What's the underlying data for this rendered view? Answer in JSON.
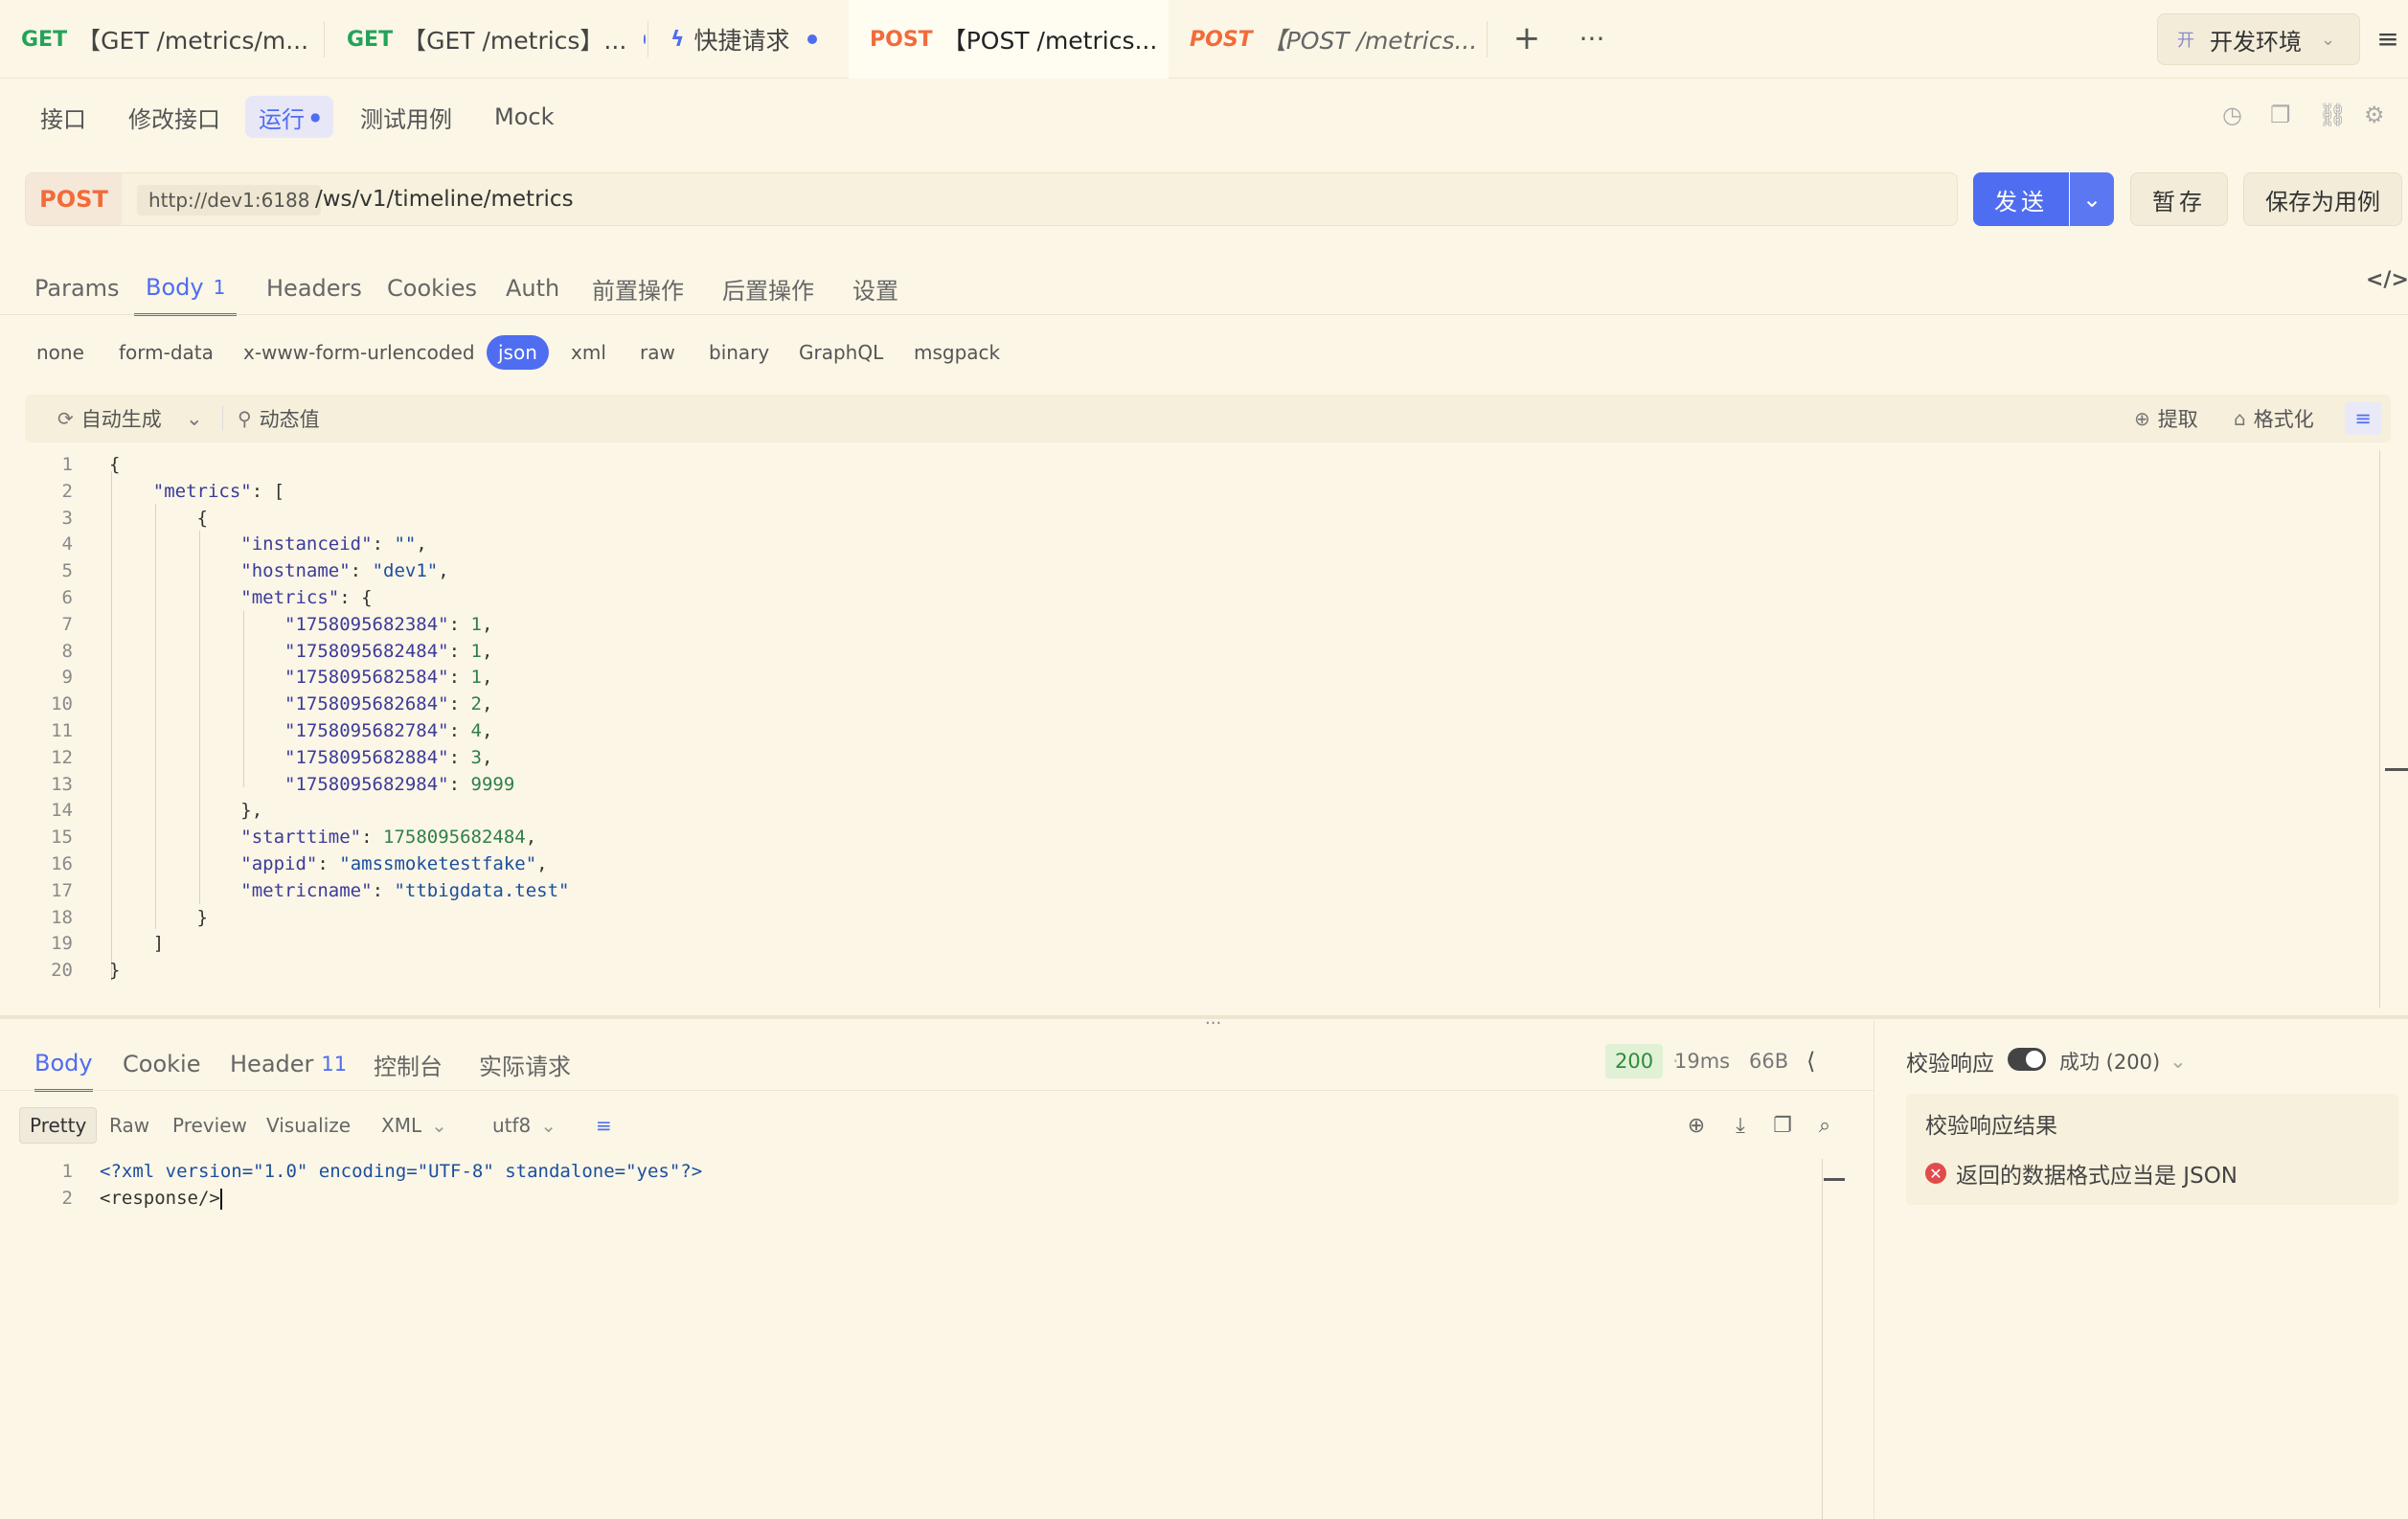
{
  "tabs": [
    {
      "method": "GET",
      "title": "【GET /metrics/m...",
      "dot": true
    },
    {
      "method": "GET",
      "title": "【GET /metrics】...",
      "dot": true
    },
    {
      "method": "",
      "title": "快捷请求",
      "dot": true
    },
    {
      "method": "POST",
      "title": "【POST /metrics...",
      "dot": true
    },
    {
      "method": "POST",
      "title": "【POST /metrics...",
      "dot": false
    }
  ],
  "env": {
    "prefix": "开",
    "label": "开发环境"
  },
  "subnav": [
    "接口",
    "修改接口",
    "运行",
    "测试用例",
    "Mock"
  ],
  "request": {
    "method": "POST",
    "host": "http://dev1:6188",
    "path": "/ws/v1/timeline/metrics",
    "send_label": "发送",
    "save_tmp_label": "暂存",
    "save_case_label": "保存为用例"
  },
  "req_tabs": [
    {
      "label": "Params"
    },
    {
      "label": "Body",
      "badge": "1"
    },
    {
      "label": "Headers"
    },
    {
      "label": "Cookies"
    },
    {
      "label": "Auth"
    },
    {
      "label": "前置操作"
    },
    {
      "label": "后置操作"
    },
    {
      "label": "设置"
    }
  ],
  "body_types": [
    "none",
    "form-data",
    "x-www-form-urlencoded",
    "json",
    "xml",
    "raw",
    "binary",
    "GraphQL",
    "msgpack"
  ],
  "editor_toolbar": {
    "auto_gen": "自动生成",
    "dynamic": "动态值",
    "extract": "提取",
    "format": "格式化"
  },
  "code_lines": [
    "{",
    "    \"metrics\": [",
    "        {",
    "            \"instanceid\": \"\",",
    "            \"hostname\": \"dev1\",",
    "            \"metrics\": {",
    "                \"1758095682384\": 1,",
    "                \"1758095682484\": 1,",
    "                \"1758095682584\": 1,",
    "                \"1758095682684\": 2,",
    "                \"1758095682784\": 4,",
    "                \"1758095682884\": 3,",
    "                \"1758095682984\": 9999",
    "            },",
    "            \"starttime\": 1758095682484,",
    "            \"appid\": \"amssmoketestfake\",",
    "            \"metricname\": \"ttbigdata.test\"",
    "        }",
    "    ]",
    "}"
  ],
  "response": {
    "tabs": [
      {
        "label": "Body"
      },
      {
        "label": "Cookie"
      },
      {
        "label": "Header",
        "badge": "11"
      },
      {
        "label": "控制台"
      },
      {
        "label": "实际请求"
      }
    ],
    "status": "200",
    "time": "19ms",
    "size": "66B",
    "formats": [
      "Pretty",
      "Raw",
      "Preview",
      "Visualize"
    ],
    "lang": "XML",
    "encoding": "utf8",
    "lines": [
      "<?xml version=\"1.0\" encoding=\"UTF-8\" standalone=\"yes\"?>",
      "<response/>"
    ]
  },
  "validation": {
    "label": "校验响应",
    "result_status": "成功 (200)",
    "result_title": "校验响应结果",
    "error_msg": "返回的数据格式应当是 JSON"
  },
  "colors": {
    "accent": "#4f6df0",
    "get": "#23a35a",
    "post": "#f26b3a",
    "error": "#e14b4b"
  }
}
